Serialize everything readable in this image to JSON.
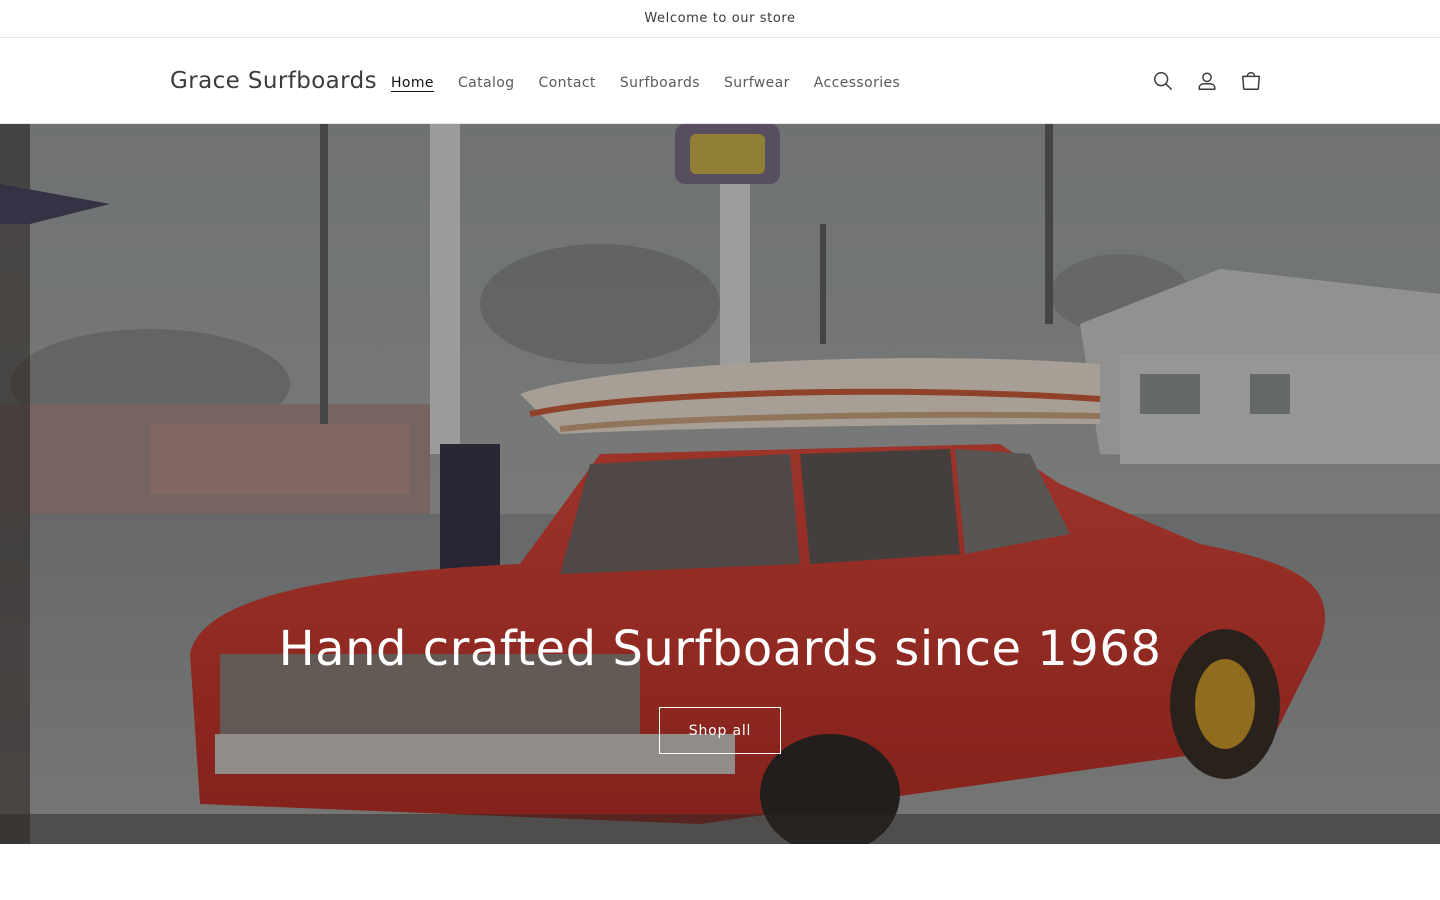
{
  "announcement": {
    "text": "Welcome to our store"
  },
  "header": {
    "logo": "Grace Surfboards",
    "nav": [
      {
        "label": "Home",
        "active": true
      },
      {
        "label": "Catalog"
      },
      {
        "label": "Contact"
      },
      {
        "label": "Surfboards"
      },
      {
        "label": "Surfwear"
      },
      {
        "label": "Accessories"
      }
    ],
    "icons": [
      "search-icon",
      "account-icon",
      "cart-icon"
    ]
  },
  "hero": {
    "title": "Hand crafted Surfboards since 1968",
    "button_label": "Shop all",
    "image_subject": "vintage red sedan with surfboards on roof rack at a gas station in the rain"
  },
  "colors": {
    "text": "#121212",
    "nav_text": "#5a5a5a",
    "border": "#e6e6e6",
    "car_red": "#c8352b"
  }
}
